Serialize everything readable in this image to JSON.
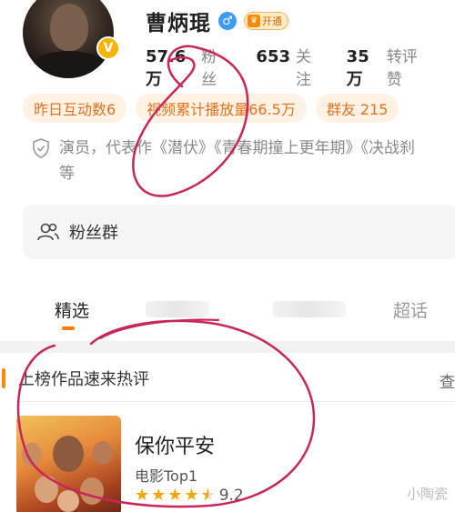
{
  "profile": {
    "name": "曹炳琨",
    "gender_icon": "male-icon",
    "vip_label": "开通",
    "verified_icon": "verified-v-icon"
  },
  "stats": {
    "followers_value": "57.6万",
    "followers_label": "粉丝",
    "following_value": "653",
    "following_label": "关注",
    "engagement_value": "35万",
    "engagement_label": "转评赞"
  },
  "tags": [
    {
      "label": "昨日互动数6"
    },
    {
      "label": "视频累计播放量66.5万"
    },
    {
      "label": "群友 215"
    }
  ],
  "bio": {
    "line1": "演员，代表作《潜伏》《青春期撞上更年期》《决战刹",
    "line2": "等"
  },
  "fan_group": {
    "label": "粉丝群"
  },
  "tabs": [
    {
      "label": "精选"
    },
    {
      "label": "超话"
    }
  ],
  "section": {
    "title": "上榜作品速来热评",
    "more": "查"
  },
  "work": {
    "title": "保你平安",
    "rank": "电影Top1",
    "rating": 4.5,
    "score": "9.2"
  },
  "watermark": "小陶瓷",
  "colors": {
    "accent_orange": "#ff7a00",
    "tag_text": "#e3721d",
    "tag_bg": "#fff1e4",
    "scribble": "#c8245e"
  }
}
